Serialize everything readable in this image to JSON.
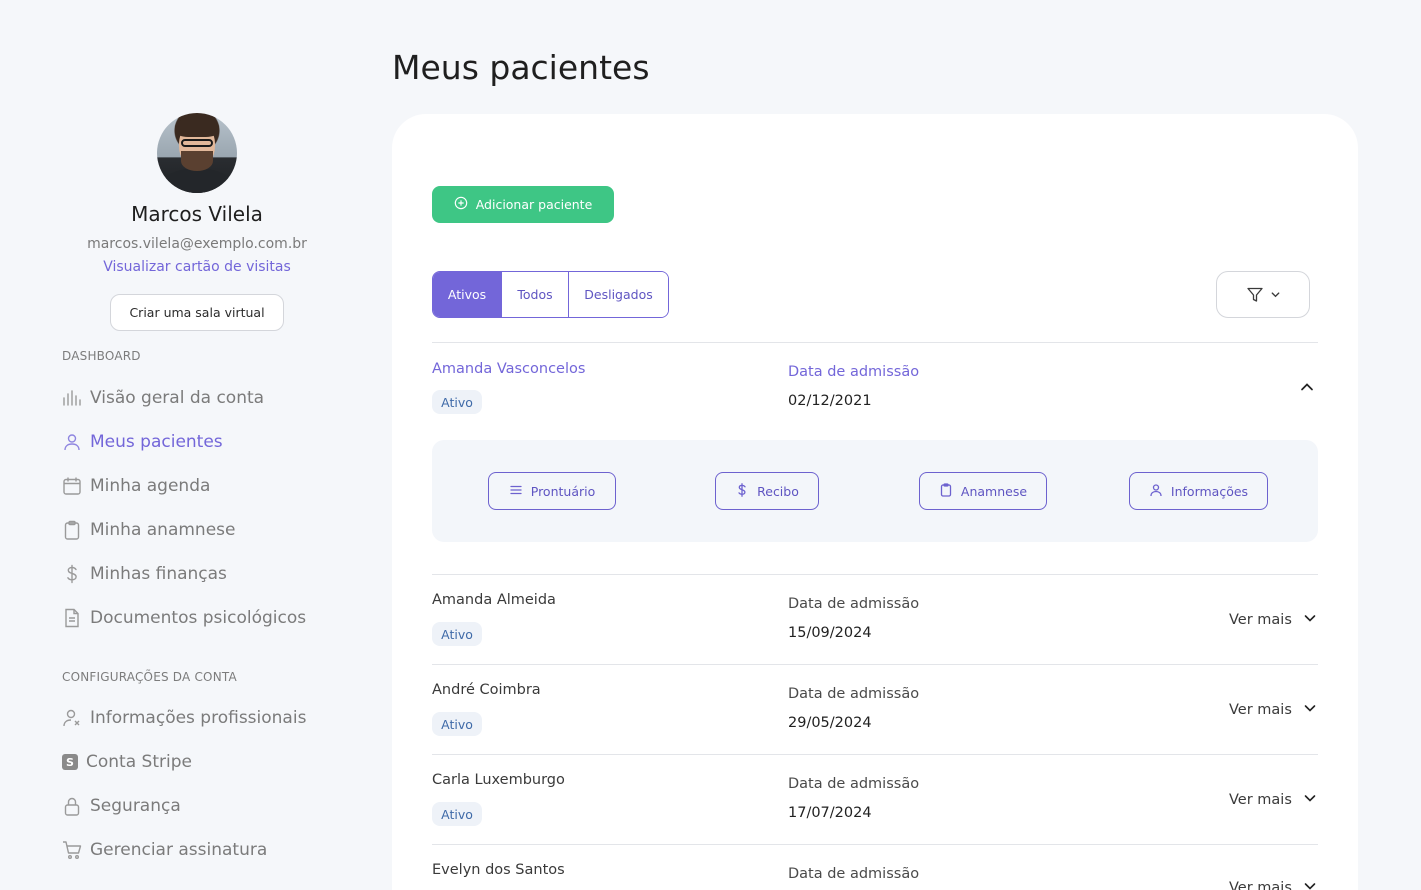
{
  "profile": {
    "name": "Marcos Vilela",
    "email": "marcos.vilela@exemplo.com.br",
    "card_link": "Visualizar cartão de visitas",
    "virtual_room_button": "Criar uma sala virtual"
  },
  "sidebar": {
    "dashboard_label": "DASHBOARD",
    "dashboard_items": [
      {
        "label": "Visão geral da conta",
        "icon": "bar-chart-icon"
      },
      {
        "label": "Meus pacientes",
        "icon": "user-icon",
        "active": true
      },
      {
        "label": "Minha agenda",
        "icon": "calendar-icon"
      },
      {
        "label": "Minha anamnese",
        "icon": "clipboard-icon"
      },
      {
        "label": "Minhas finanças",
        "icon": "dollar-icon"
      },
      {
        "label": "Documentos psicológicos",
        "icon": "document-icon"
      }
    ],
    "settings_label": "CONFIGURAÇÕES DA CONTA",
    "settings_items": [
      {
        "label": "Informações profissionais",
        "icon": "user-settings-icon"
      },
      {
        "label": "Conta Stripe",
        "icon": "stripe-icon"
      },
      {
        "label": "Segurança",
        "icon": "lock-icon"
      },
      {
        "label": "Gerenciar assinatura",
        "icon": "cart-icon"
      }
    ]
  },
  "main": {
    "title": "Meus pacientes",
    "add_button": "Adicionar paciente",
    "tabs": [
      {
        "label": "Ativos",
        "active": true
      },
      {
        "label": "Todos"
      },
      {
        "label": "Desligados"
      }
    ],
    "admission_label": "Data de admissão",
    "see_more": "Ver mais",
    "patients": [
      {
        "name": "Amanda Vasconcelos",
        "status": "Ativo",
        "admission_date": "02/12/2021",
        "expanded": true
      },
      {
        "name": "Amanda Almeida",
        "status": "Ativo",
        "admission_date": "15/09/2024"
      },
      {
        "name": "André Coimbra",
        "status": "Ativo",
        "admission_date": "29/05/2024"
      },
      {
        "name": "Carla Luxemburgo",
        "status": "Ativo",
        "admission_date": "17/07/2024"
      },
      {
        "name": "Evelyn dos Santos",
        "status": "",
        "admission_date": ""
      }
    ],
    "actions": [
      {
        "label": "Prontuário",
        "icon": "list-icon"
      },
      {
        "label": "Recibo",
        "icon": "dollar-icon"
      },
      {
        "label": "Anamnese",
        "icon": "clipboard-icon"
      },
      {
        "label": "Informações",
        "icon": "user-icon"
      }
    ]
  },
  "colors": {
    "accent": "#7366d9",
    "success": "#3ec685",
    "background": "#f5f7fa",
    "badge_bg": "#eef2f8",
    "badge_text": "#3f6aa8"
  }
}
